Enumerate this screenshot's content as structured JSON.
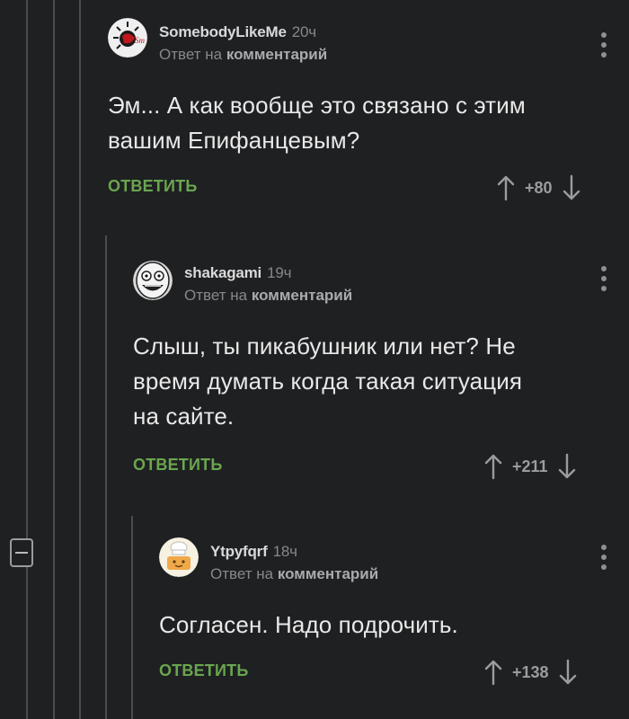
{
  "colors": {
    "background": "#1f2022",
    "accent_green": "#6aa64f",
    "thread_line": "#4a4c50",
    "muted_text": "#85888c"
  },
  "comments": [
    {
      "username": "SomebodyLikeMe",
      "time": "20ч",
      "reply_prefix": "Ответ на",
      "reply_target": "комментарий",
      "text_lines": [
        "Эм... А как вообще это связано с этим",
        "вашим Епифанцевым?"
      ],
      "reply_label": "ОТВЕТИТЬ",
      "score": "+80",
      "avatar_icon": "sun-avatar-icon"
    },
    {
      "username": "shakagami",
      "time": "19ч",
      "reply_prefix": "Ответ на",
      "reply_target": "комментарий",
      "text_lines": [
        "Слыш, ты пикабушник или нет? Не",
        "время думать когда такая ситуация",
        "на сайте."
      ],
      "reply_label": "ОТВЕТИТЬ",
      "score": "+211",
      "avatar_icon": "meme-face-avatar-icon"
    },
    {
      "username": "Ytpyfqrf",
      "time": "18ч",
      "reply_prefix": "Ответ на",
      "reply_target": "комментарий",
      "text_lines": [
        "Согласен. Надо подрочить."
      ],
      "reply_label": "ОТВЕТИТЬ",
      "score": "+138",
      "avatar_icon": "chef-avatar-icon"
    }
  ],
  "icons": {
    "collapse": "collapse-thread-icon",
    "menu": "more-options-icon",
    "upvote": "arrow-up-icon",
    "downvote": "arrow-down-icon"
  }
}
